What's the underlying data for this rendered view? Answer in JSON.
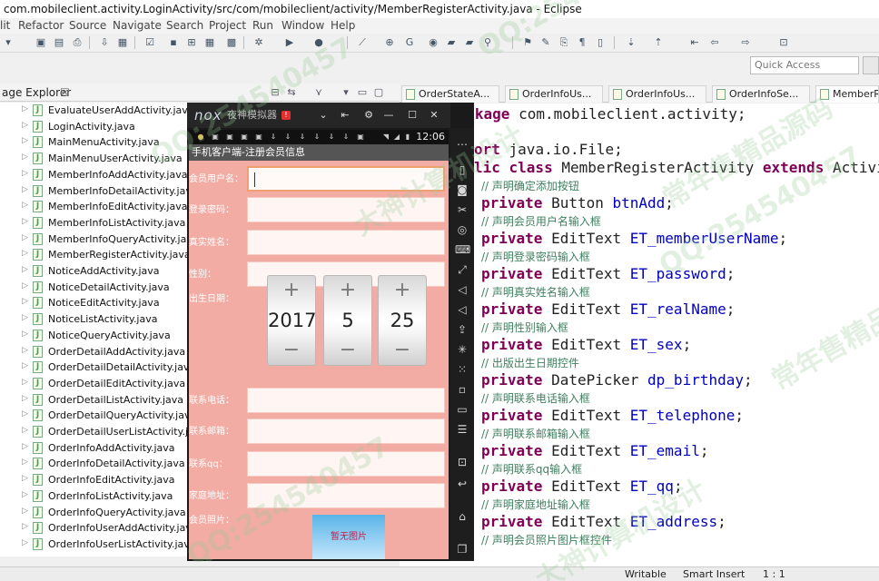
{
  "window": {
    "title": "com.mobileclient.activity.LoginActivity/src/com/mobileclient/activity/MemberRegisterActivity.java - Eclipse"
  },
  "menu": [
    "lit",
    "Refactor",
    "Source",
    "Navigate",
    "Search",
    "Project",
    "Run",
    "Window",
    "Help"
  ],
  "quick_access": {
    "placeholder": "Quick Access"
  },
  "package_explorer": {
    "title": "age Explorer",
    "close": "☒",
    "items": [
      "EvaluateUserAddActivity.java",
      "LoginActivity.java",
      "MainMenuActivity.java",
      "MainMenuUserActivity.java",
      "MemberInfoAddActivity.java",
      "MemberInfoDetailActivity.java",
      "MemberInfoEditActivity.java",
      "MemberInfoListActivity.java",
      "MemberInfoQueryActivity.java",
      "MemberRegisterActivity.java",
      "NoticeAddActivity.java",
      "NoticeDetailActivity.java",
      "NoticeEditActivity.java",
      "NoticeListActivity.java",
      "NoticeQueryActivity.java",
      "OrderDetailAddActivity.java",
      "OrderDetailDetailActivity.java",
      "OrderDetailEditActivity.java",
      "OrderDetailListActivity.java",
      "OrderDetailQueryActivity.java",
      "OrderDetailUserListActivity.jav",
      "OrderInfoAddActivity.java",
      "OrderInfoDetailActivity.java",
      "OrderInfoEditActivity.java",
      "OrderInfoListActivity.java",
      "OrderInfoQueryActivity.java",
      "OrderInfoUserAddActivity.java",
      "OrderInfoUserListActivity.java"
    ]
  },
  "editor_tabs": [
    "OrderStateA...",
    "OrderInfoUs...",
    "OrderInfoUs...",
    "OrderInfoSe...",
    "MemberRe"
  ],
  "code": {
    "l1_kw": "package",
    "l1_rest": " com.mobileclient.activity;",
    "l2_kw": "ort",
    "l2_rest": " java.io.File;",
    "l3_kw1": "lic class",
    "l3_mid": " MemberRegisterActivity ",
    "l3_kw2": "extends",
    "l3_rest": " Activity -",
    "c1": "// 声明确定添加按钮",
    "f1_type": " Button ",
    "f1_name": "btnAdd",
    "c2": "// 声明会员用户名输入框",
    "f2_type": " EditText ",
    "f2_name": "ET_memberUserName",
    "c3": "// 声明登录密码输入框",
    "f3_type": " EditText ",
    "f3_name": "ET_password",
    "c4": "// 声明真实姓名输入框",
    "f4_type": " EditText ",
    "f4_name": "ET_realName",
    "c5": "// 声明性别输入框",
    "f5_type": " EditText ",
    "f5_name": "ET_sex",
    "c6": "// 出版出生日期控件",
    "f6_type": " DatePicker ",
    "f6_name": "dp_birthday",
    "c7": "// 声明联系电话输入框",
    "f7_type": " EditText ",
    "f7_name": "ET_telephone",
    "c8": "// 声明联系邮箱输入框",
    "f8_type": " EditText ",
    "f8_name": "ET_email",
    "c9": "// 声明联系qq输入框",
    "f9_type": " EditText ",
    "f9_name": "ET_qq",
    "c10": "// 声明家庭地址输入框",
    "f10_type": " EditText ",
    "f10_name": "ET_address",
    "c11": "// 声明会员照片图片框控件",
    "private": "private",
    "semi": ";"
  },
  "status": {
    "writable": "Writable",
    "insert": "Smart Insert",
    "pos": "1 : 1"
  },
  "emulator": {
    "logo": "nox",
    "name": "夜神模拟器",
    "badge": "!",
    "time": "12:06",
    "app_title": "手机客户端-注册会员信息",
    "labels": {
      "username": "会员用户名：",
      "password": "登录密码：",
      "realname": "真实姓名：",
      "sex": "性别：",
      "birthday": "出生日期：",
      "telephone": "联系电话：",
      "email": "联系邮箱：",
      "qq": "联系qq：",
      "address": "家庭地址：",
      "photo": "会员照片："
    },
    "date": {
      "year": "2017",
      "month": "5",
      "day": "25",
      "plus": "+",
      "minus": "−"
    },
    "no_photo": "暂无图片"
  },
  "watermarks": [
    "QQ:254540457",
    "大神计算机设计",
    "常年售精品源码"
  ]
}
